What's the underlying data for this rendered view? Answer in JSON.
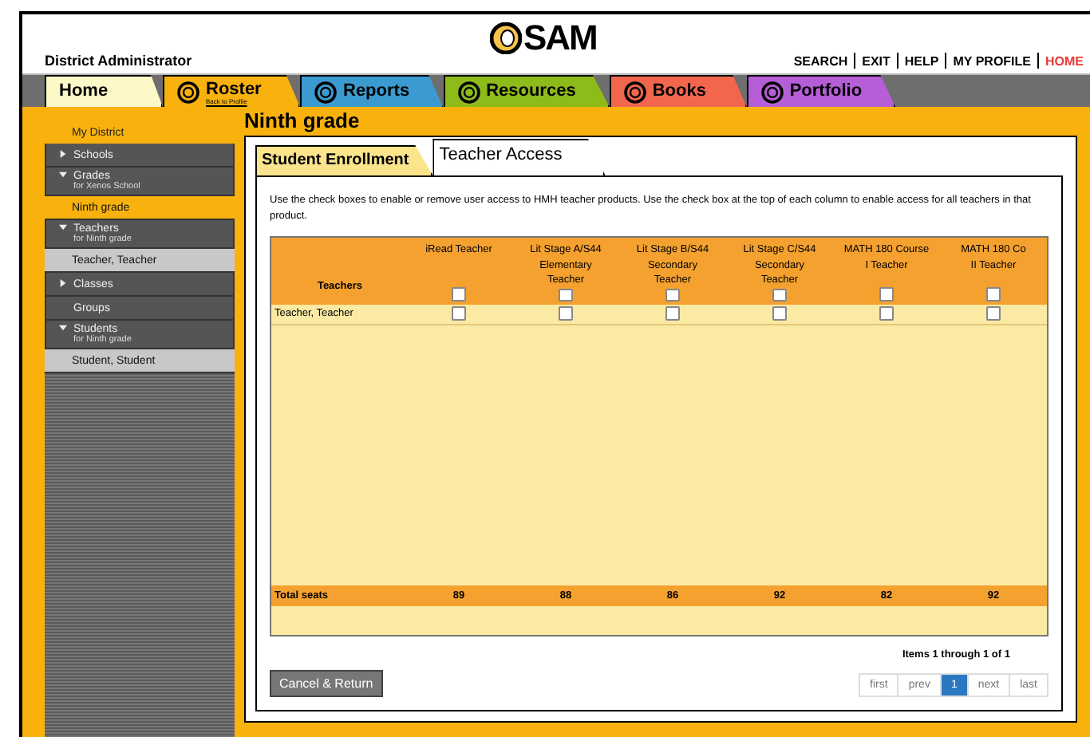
{
  "header": {
    "role": "District Administrator",
    "logo": "SAM",
    "links": [
      {
        "label": "SEARCH",
        "kind": "plain"
      },
      {
        "label": "EXIT",
        "kind": "plain"
      },
      {
        "label": "HELP",
        "kind": "plain"
      },
      {
        "label": "MY PROFILE",
        "kind": "plain"
      },
      {
        "label": "HOME",
        "kind": "accent"
      }
    ]
  },
  "nav_tabs": [
    {
      "label": "Home",
      "selected": false,
      "color": "#fdf8c8"
    },
    {
      "label": "Roster",
      "sub": "Back to Profile",
      "selected": true,
      "color": "#f9b20d"
    },
    {
      "label": "Reports",
      "selected": false,
      "color": "#3b9bd1"
    },
    {
      "label": "Resources",
      "selected": false,
      "color": "#8dbb1a"
    },
    {
      "label": "Books",
      "selected": false,
      "color": "#f2664d"
    },
    {
      "label": "Portfolio",
      "selected": false,
      "color": "#b65ed8"
    }
  ],
  "sidebar": {
    "items": [
      {
        "label": "My District",
        "kind": "header"
      },
      {
        "label": "Schools",
        "kind": "group",
        "expanded": false
      },
      {
        "label": "Grades",
        "sub": "for Xenos School",
        "kind": "group",
        "expanded": true
      },
      {
        "label": "Ninth grade",
        "kind": "current"
      },
      {
        "label": "Teachers",
        "sub": "for Ninth grade",
        "kind": "group",
        "expanded": true
      },
      {
        "label": "Teacher, Teacher",
        "kind": "leaf"
      },
      {
        "label": "Classes",
        "kind": "group",
        "expanded": false
      },
      {
        "label": "Groups",
        "kind": "group"
      },
      {
        "label": "Students",
        "sub": "for Ninth grade",
        "kind": "group",
        "expanded": true
      },
      {
        "label": "Student, Student",
        "kind": "leaf"
      }
    ]
  },
  "page_title": "Ninth grade",
  "tabs": [
    {
      "label": "Student Enrollment",
      "selected": false
    },
    {
      "label": "Teacher Access",
      "selected": true
    }
  ],
  "instructions": "Use the check boxes to enable or remove user access to HMH teacher products. Use the check box at the top of each column to enable access for all teachers in that product.",
  "table": {
    "first_column": "Teachers",
    "columns": [
      {
        "lines": [
          "iRead Teacher"
        ],
        "checked": false
      },
      {
        "lines": [
          "Lit Stage A/S44",
          "Elementary",
          "Teacher"
        ],
        "checked": false
      },
      {
        "lines": [
          "Lit Stage B/S44",
          "Secondary",
          "Teacher"
        ],
        "checked": false
      },
      {
        "lines": [
          "Lit Stage C/S44",
          "Secondary",
          "Teacher"
        ],
        "checked": false
      },
      {
        "lines": [
          "MATH 180 Course",
          "I Teacher"
        ],
        "checked": false
      },
      {
        "lines": [
          "MATH 180 Co",
          "II Teacher"
        ],
        "checked": false
      }
    ],
    "rows": [
      {
        "name": "Teacher, Teacher",
        "checks": [
          false,
          false,
          false,
          false,
          false,
          false
        ]
      }
    ],
    "totals": {
      "label": "Total seats",
      "values": [
        "89",
        "88",
        "86",
        "92",
        "82",
        "92"
      ]
    }
  },
  "pager": {
    "summary": "Items 1 through 1 of 1",
    "pages": [
      {
        "label": "first",
        "selected": false
      },
      {
        "label": "prev",
        "selected": false
      },
      {
        "label": "1",
        "selected": true
      },
      {
        "label": "next",
        "selected": false
      },
      {
        "label": "last",
        "selected": false
      }
    ]
  },
  "cancel_button": "Cancel & Return"
}
